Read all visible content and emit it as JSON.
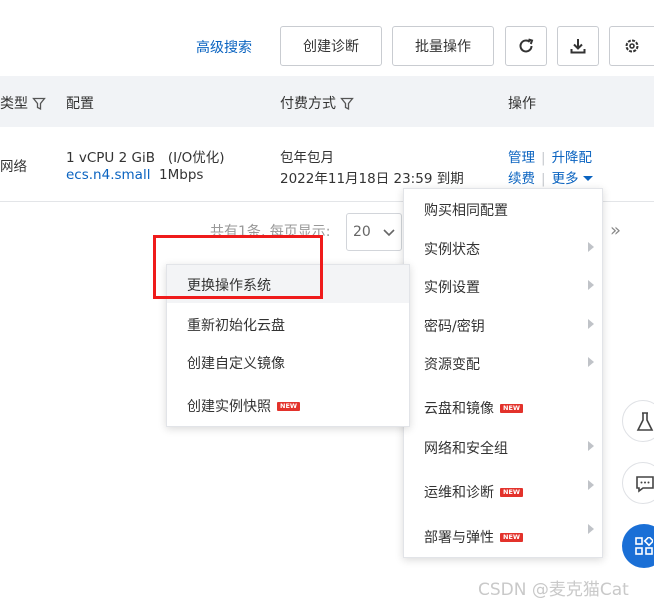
{
  "toolbar": {
    "advanced_search": "高级搜索",
    "create_diagnosis": "创建诊断",
    "batch_operation": "批量操作"
  },
  "table": {
    "headers": {
      "type": "类型",
      "config": "配置",
      "payment": "付费方式",
      "actions": "操作"
    },
    "row": {
      "network": "网络",
      "spec": "1 vCPU 2 GiB",
      "spec_note": "(I/O优化)",
      "instance_type": "ecs.n4.small",
      "bandwidth": "1Mbps",
      "billing": "包年包月",
      "expire": "2022年11月18日 23:59 到期",
      "manage": "管理",
      "upgrade": "升降配",
      "renew": "续费",
      "more": "更多"
    }
  },
  "pager": {
    "text": "共有1条, 每页显示:",
    "page_size": "20"
  },
  "submenu": [
    {
      "label": "更换操作系统",
      "badge": ""
    },
    {
      "label": "重新初始化云盘",
      "badge": ""
    },
    {
      "label": "创建自定义镜像",
      "badge": ""
    },
    {
      "label": "创建实例快照",
      "badge": "NEW"
    }
  ],
  "dropdown": [
    {
      "label": "购买相同配置",
      "badge": "",
      "arrow": false
    },
    {
      "label": "实例状态",
      "badge": "",
      "arrow": true
    },
    {
      "label": "实例设置",
      "badge": "",
      "arrow": true
    },
    {
      "label": "密码/密钥",
      "badge": "",
      "arrow": true
    },
    {
      "label": "资源变配",
      "badge": "",
      "arrow": true
    },
    {
      "label": "云盘和镜像",
      "badge": "NEW",
      "arrow": false
    },
    {
      "label": "网络和安全组",
      "badge": "",
      "arrow": true
    },
    {
      "label": "运维和诊断",
      "badge": "NEW",
      "arrow": true
    },
    {
      "label": "部署与弹性",
      "badge": "NEW",
      "arrow": true
    }
  ],
  "watermark": "CSDN @麦克猫Cat",
  "colors": {
    "link": "#0a63c0",
    "highlight": "#ef1b1b",
    "badge": "#e3322b",
    "float_primary": "#1a6fd6"
  }
}
